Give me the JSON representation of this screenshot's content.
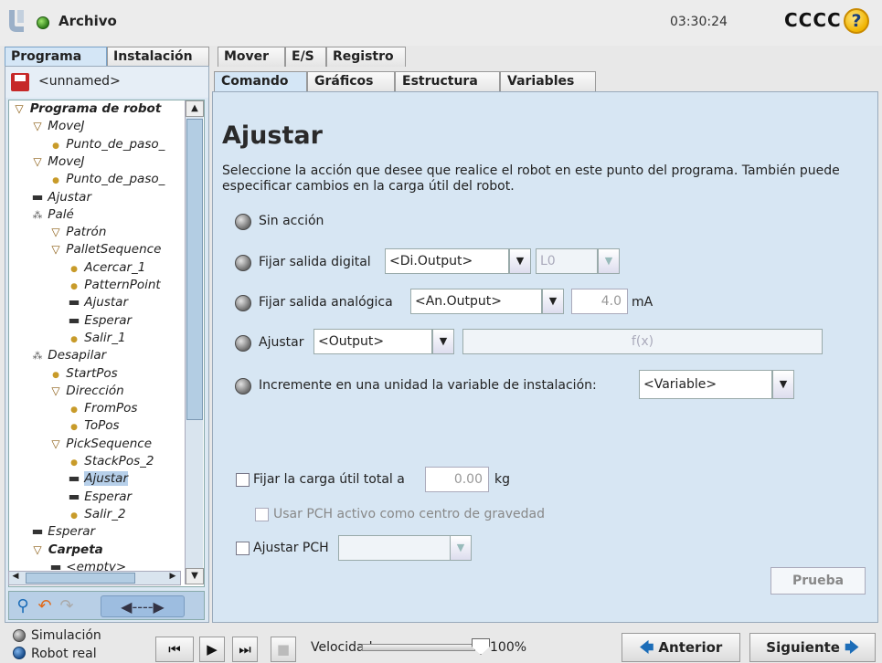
{
  "topbar": {
    "file_menu": "Archivo",
    "clock": "03:30:24",
    "robot_name": "CCCC",
    "help": "?"
  },
  "tabs": [
    {
      "label": "Programa",
      "active": true
    },
    {
      "label": "Instalación",
      "active": false
    },
    {
      "label": "Mover",
      "active": false
    },
    {
      "label": "E/S",
      "active": false
    },
    {
      "label": "Registro",
      "active": false
    }
  ],
  "program": {
    "file_name": "<unnamed>"
  },
  "tree": [
    {
      "label": "Programa de robot",
      "icon": "triangle",
      "depth": 0,
      "bold": true
    },
    {
      "label": "MoveJ",
      "icon": "triangle",
      "depth": 1
    },
    {
      "label": "Punto_de_paso_",
      "icon": "dot",
      "depth": 2
    },
    {
      "label": "MoveJ",
      "icon": "triangle",
      "depth": 1
    },
    {
      "label": "Punto_de_paso_",
      "icon": "dot",
      "depth": 2
    },
    {
      "label": "Ajustar",
      "icon": "dash",
      "depth": 1
    },
    {
      "label": "Palé",
      "icon": "pallet",
      "depth": 1
    },
    {
      "label": "Patrón",
      "icon": "triangle",
      "depth": 2
    },
    {
      "label": "PalletSequence",
      "icon": "triangle",
      "depth": 2
    },
    {
      "label": "Acercar_1",
      "icon": "dot",
      "depth": 3
    },
    {
      "label": "PatternPoint",
      "icon": "dot",
      "depth": 3
    },
    {
      "label": "Ajustar",
      "icon": "dash",
      "depth": 3
    },
    {
      "label": "Esperar",
      "icon": "dash",
      "depth": 3
    },
    {
      "label": "Salir_1",
      "icon": "dot",
      "depth": 3
    },
    {
      "label": "Desapilar",
      "icon": "pallet",
      "depth": 1
    },
    {
      "label": "StartPos",
      "icon": "dot",
      "depth": 2
    },
    {
      "label": "Dirección",
      "icon": "triangle",
      "depth": 2
    },
    {
      "label": "FromPos",
      "icon": "dot",
      "depth": 3
    },
    {
      "label": "ToPos",
      "icon": "dot",
      "depth": 3
    },
    {
      "label": "PickSequence",
      "icon": "triangle",
      "depth": 2
    },
    {
      "label": "StackPos_2",
      "icon": "dot",
      "depth": 3
    },
    {
      "label": "Ajustar",
      "icon": "dash",
      "depth": 3,
      "selected": true
    },
    {
      "label": "Esperar",
      "icon": "dash",
      "depth": 3
    },
    {
      "label": "Salir_2",
      "icon": "dot",
      "depth": 3
    },
    {
      "label": "Esperar",
      "icon": "dash",
      "depth": 1
    },
    {
      "label": "Carpeta",
      "icon": "triangle",
      "depth": 1,
      "bold": true
    },
    {
      "label": "<empty>",
      "icon": "dash",
      "depth": 2
    }
  ],
  "subtabs": [
    {
      "label": "Comando",
      "active": true
    },
    {
      "label": "Gráficos",
      "active": false
    },
    {
      "label": "Estructura",
      "active": false
    },
    {
      "label": "Variables",
      "active": false
    }
  ],
  "command": {
    "title": "Ajustar",
    "description": "Seleccione la acción que desee que realice el robot en este punto del programa. También puede especificar cambios en la carga útil del robot.",
    "no_action": "Sin acción",
    "digital_label": "Fijar salida digital",
    "digital_select": "<Di.Output>",
    "digital_value": "L0",
    "analog_label": "Fijar salida analógica",
    "analog_select": "<An.Output>",
    "analog_value": "4.0",
    "analog_unit": "mA",
    "set_label": "Ajustar",
    "set_select": "<Output>",
    "set_expression": "f(x)",
    "increment_label": "Incremente en una unidad la variable de instalación:",
    "increment_select": "<Variable>",
    "payload_label": "Fijar la carga útil total a",
    "payload_value": "0.00",
    "payload_unit": "kg",
    "tcp_cog_label": "Usar PCH activo como centro de gravedad",
    "set_tcp_label": "Ajustar PCH",
    "test_button": "Prueba"
  },
  "bottombar": {
    "simulation": "Simulación",
    "real_robot": "Robot real",
    "speed_label": "Velocidad",
    "speed_value": "100%",
    "speed_fraction": 1.0,
    "previous": "Anterior",
    "next": "Siguiente"
  }
}
